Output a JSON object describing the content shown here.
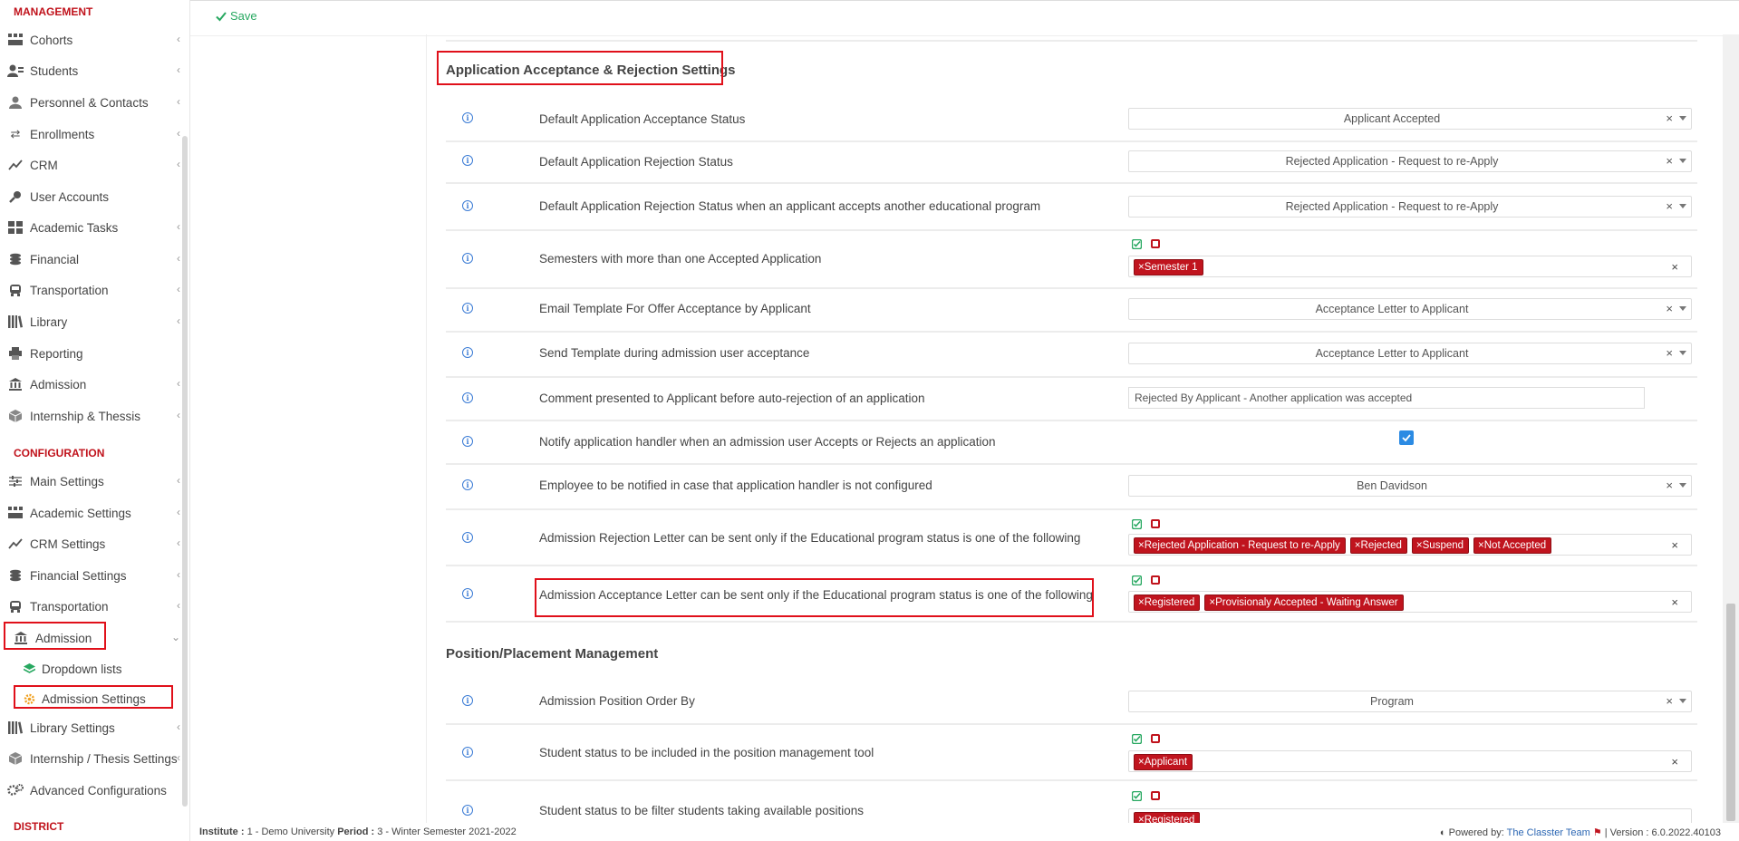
{
  "toolbar": {
    "save_label": "Save"
  },
  "sidebar": {
    "management_heading": "MANAGEMENT",
    "management_items": [
      {
        "label": "Cohorts",
        "icon": "cohorts-icon"
      },
      {
        "label": "Students",
        "icon": "students-icon"
      },
      {
        "label": "Personnel & Contacts",
        "icon": "personnel-icon"
      },
      {
        "label": "Enrollments",
        "icon": "enrollments-icon"
      },
      {
        "label": "CRM",
        "icon": "crm-icon"
      },
      {
        "label": "User Accounts",
        "icon": "key-icon"
      },
      {
        "label": "Academic Tasks",
        "icon": "grid-icon"
      },
      {
        "label": "Financial",
        "icon": "coins-icon"
      },
      {
        "label": "Transportation",
        "icon": "bus-icon"
      },
      {
        "label": "Library",
        "icon": "books-icon"
      },
      {
        "label": "Reporting",
        "icon": "printer-icon"
      },
      {
        "label": "Admission",
        "icon": "institution-icon"
      },
      {
        "label": "Internship & Thessis",
        "icon": "box-icon"
      }
    ],
    "configuration_heading": "CONFIGURATION",
    "configuration_items": [
      {
        "label": "Main Settings",
        "icon": "sliders-icon"
      },
      {
        "label": "Academic Settings",
        "icon": "cohorts-icon"
      },
      {
        "label": "CRM Settings",
        "icon": "crm-icon"
      },
      {
        "label": "Financial Settings",
        "icon": "coins-icon"
      },
      {
        "label": "Transportation",
        "icon": "bus-icon"
      },
      {
        "label": "Admission",
        "icon": "institution-icon"
      },
      {
        "label": "Dropdown lists",
        "icon": "layers-icon"
      },
      {
        "label": "Admission Settings",
        "icon": "cog-icon"
      },
      {
        "label": "Library Settings",
        "icon": "books-icon"
      },
      {
        "label": "Internship / Thesis Settings",
        "icon": "box-icon"
      },
      {
        "label": "Advanced Configurations",
        "icon": "cogs-icon"
      }
    ],
    "district_heading": "DISTRICT"
  },
  "sections": {
    "acceptance_title": "Application Acceptance & Rejection Settings",
    "position_title": "Position/Placement Management"
  },
  "rows": [
    {
      "label": "Default Application Acceptance Status",
      "value": "Applicant Accepted"
    },
    {
      "label": "Default Application Rejection Status",
      "value": "Rejected Application - Request to re-Apply"
    },
    {
      "label": "Default Application Rejection Status when an applicant accepts another educational program",
      "value": "Rejected Application - Request to re-Apply"
    },
    {
      "label": "Semesters with more than one Accepted Application",
      "tags": [
        "Semester 1"
      ]
    },
    {
      "label": "Email Template For Offer Acceptance by Applicant",
      "value": "Acceptance Letter to Applicant"
    },
    {
      "label": "Send Template during admission user acceptance",
      "value": "Acceptance Letter to Applicant"
    },
    {
      "label": "Comment presented to Applicant before auto-rejection of an application",
      "text": "Rejected By Applicant - Another application was accepted"
    },
    {
      "label": "Notify application handler when an admission user Accepts or Rejects an application",
      "checked": true
    },
    {
      "label": "Employee to be notified in case that application handler is not configured",
      "value": "Ben Davidson"
    },
    {
      "label": "Admission Rejection Letter can be sent only if the Educational program status is one of the following",
      "tags": [
        "Rejected Application - Request to re-Apply",
        "Rejected",
        "Suspend",
        "Not Accepted"
      ]
    },
    {
      "label": "Admission Acceptance Letter can be sent only if the Educational program status is one of the following",
      "tags": [
        "Registered",
        "Provisionaly Accepted - Waiting Answer"
      ]
    },
    {
      "label": "Admission Position Order By",
      "value": "Program"
    },
    {
      "label": "Student status to be included in the position management tool",
      "tags": [
        "Applicant"
      ]
    },
    {
      "label": "Student status to be filter students taking available positions",
      "tags": [
        "Registered"
      ]
    }
  ],
  "footer": {
    "institute_label": "Institute :",
    "institute_value": "1 - Demo University",
    "period_label": "Period :",
    "period_value": "3 - Winter Semester 2021-2022",
    "powered_by": "Powered by:",
    "team": "The Classter Team",
    "version": "| Version : 6.0.2022.40103"
  },
  "colors": {
    "accent_red": "#c0141e",
    "success_green": "#27a860",
    "link_blue": "#2b66b3",
    "checkbox_blue": "#2c8be3"
  }
}
